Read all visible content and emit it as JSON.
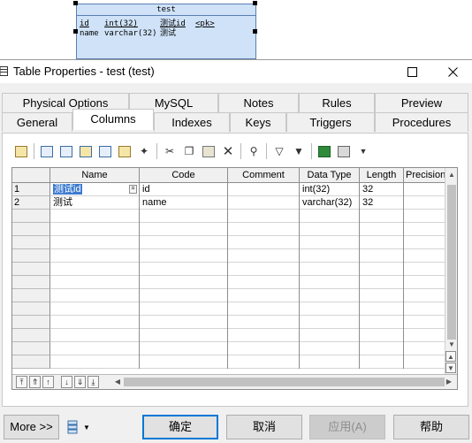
{
  "entity": {
    "name": "test",
    "rows": [
      {
        "code": "id",
        "type": "int(32)",
        "name": "测试id",
        "key": "<pk>"
      },
      {
        "code": "name",
        "type": "varchar(32)",
        "name": "测试",
        "key": ""
      }
    ]
  },
  "window": {
    "title": "Table Properties - test (test)",
    "maximize_glyph": "☐",
    "close_glyph": "✕"
  },
  "tabs": {
    "row1": [
      "Physical Options",
      "MySQL",
      "Notes",
      "Rules",
      "Preview"
    ],
    "row2": [
      "General",
      "Columns",
      "Indexes",
      "Keys",
      "Triggers",
      "Procedures"
    ],
    "active": "Columns"
  },
  "toolbar": {
    "icons": [
      "properties-icon",
      "insert-row-icon",
      "add-row-icon",
      "add-columns-icon",
      "copy-icon",
      "new-icon",
      "cut-icon",
      "copy-rows-icon",
      "paste-icon",
      "delete-icon",
      "find-icon",
      "filter-icon",
      "clear-filter-icon",
      "excel-icon",
      "print-icon",
      "dropdown-icon"
    ]
  },
  "grid": {
    "columns": [
      "",
      "Name",
      "Code",
      "Comment",
      "Data Type",
      "Length",
      "Precision"
    ],
    "rows": [
      {
        "num": "1",
        "name": "测试id",
        "code": "id",
        "comment": "",
        "type": "int(32)",
        "length": "32",
        "precision": ""
      },
      {
        "num": "2",
        "name": "测试",
        "code": "name",
        "comment": "",
        "type": "varchar(32)",
        "length": "32",
        "precision": ""
      }
    ],
    "empty_row_count": 12
  },
  "buttons": {
    "more": "More >>",
    "ok": "确定",
    "cancel": "取消",
    "apply": "应用(A)",
    "help": "帮助"
  },
  "colors": {
    "entity_fill": "#cfe2f7",
    "selection": "#3d7bd1"
  }
}
